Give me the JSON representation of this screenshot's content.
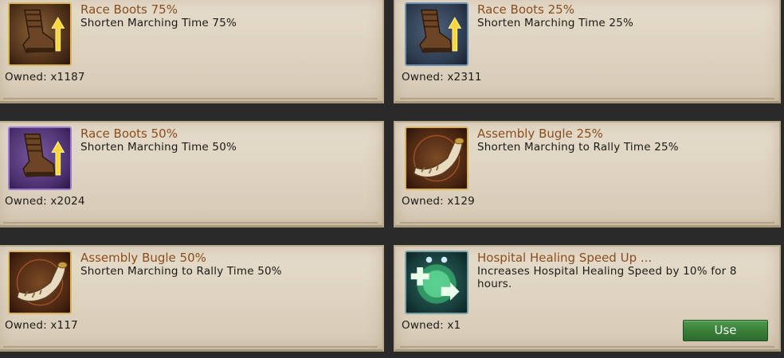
{
  "items": [
    {
      "title": "Race Boots 75%",
      "desc": "Shorten Marching Time 75%",
      "owned": "Owned: x1187",
      "icon": "race-boots-icon",
      "frame": "gold"
    },
    {
      "title": "Race Boots 25%",
      "desc": "Shorten Marching Time 25%",
      "owned": "Owned: x2311",
      "icon": "race-boots-icon",
      "frame": "blue"
    },
    {
      "title": "Race Boots 50%",
      "desc": "Shorten Marching Time 50%",
      "owned": "Owned: x2024",
      "icon": "race-boots-icon",
      "frame": "purple"
    },
    {
      "title": "Assembly Bugle 25%",
      "desc": "Shorten Marching to Rally Time 25%",
      "owned": "Owned: x129",
      "icon": "assembly-bugle-icon",
      "frame": "gold"
    },
    {
      "title": "Assembly Bugle 50%",
      "desc": "Shorten Marching to Rally Time 50%",
      "owned": "Owned: x117",
      "icon": "assembly-bugle-icon",
      "frame": "gold"
    },
    {
      "title": "Hospital Healing Speed Up ...",
      "desc": "Increases Hospital Healing Speed by 10% for 8 hours.",
      "owned": "Owned: x1",
      "icon": "hospital-healing-icon",
      "frame": "blue",
      "button": "Use"
    }
  ],
  "colors": {
    "title": "#8a4d1c",
    "button": "#3a7f3a"
  }
}
